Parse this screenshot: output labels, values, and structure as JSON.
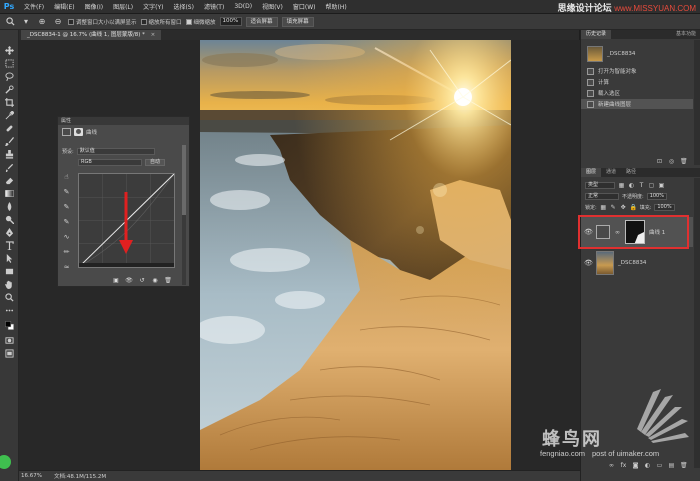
{
  "app": {
    "logo_text": "Ps",
    "menu": [
      "文件(F)",
      "编辑(E)",
      "图像(I)",
      "图层(L)",
      "文字(Y)",
      "选择(S)",
      "滤镜(T)",
      "3D(D)",
      "视图(V)",
      "窗口(W)",
      "帮助(H)"
    ],
    "watermark_brand": "思缘设计论坛",
    "watermark_site": "www.MISSYUAN.COM"
  },
  "options_bar": {
    "resize_windows": "调整窗口大小以满屏显示",
    "zoom_all": "缩放所有窗口",
    "scrubby_zoom": "细微缩放",
    "zoom_value": "100%",
    "fit_screen": "适合屏幕",
    "fill_screen": "填充屏幕"
  },
  "document": {
    "tab_title": "_DSC8834-1 @ 16.7% (曲线 1, 图层蒙版/8) *",
    "close_glyph": "×"
  },
  "status": {
    "zoom": "16.67%",
    "doc_size": "文档:48.1M/115.2M"
  },
  "properties": {
    "panel_title": "属性",
    "title": "曲线",
    "preset_label": "预设:",
    "preset_value": "默认值",
    "channel_value": "RGB",
    "auto_button": "自动"
  },
  "history": {
    "tab_label": "历史记录",
    "snapshot": "_DSC8834",
    "items": [
      "打开为智能对象",
      "计算",
      "载入选区",
      "新建曲线图层"
    ],
    "right_label": "基本功能"
  },
  "layers": {
    "tabs": [
      "图层",
      "通道",
      "路径"
    ],
    "kind_label": "类型",
    "blend_mode": "正常",
    "opacity_label": "不透明度:",
    "opacity_value": "100%",
    "lock_label": "锁定:",
    "fill_label": "填充:",
    "fill_value": "100%",
    "items": [
      {
        "name": "曲线 1"
      },
      {
        "name": "_DSC8834"
      }
    ]
  },
  "logo": {
    "cn": "蜂鸟网",
    "url": "fengniao.com",
    "sub": "post of uimaker.com"
  }
}
